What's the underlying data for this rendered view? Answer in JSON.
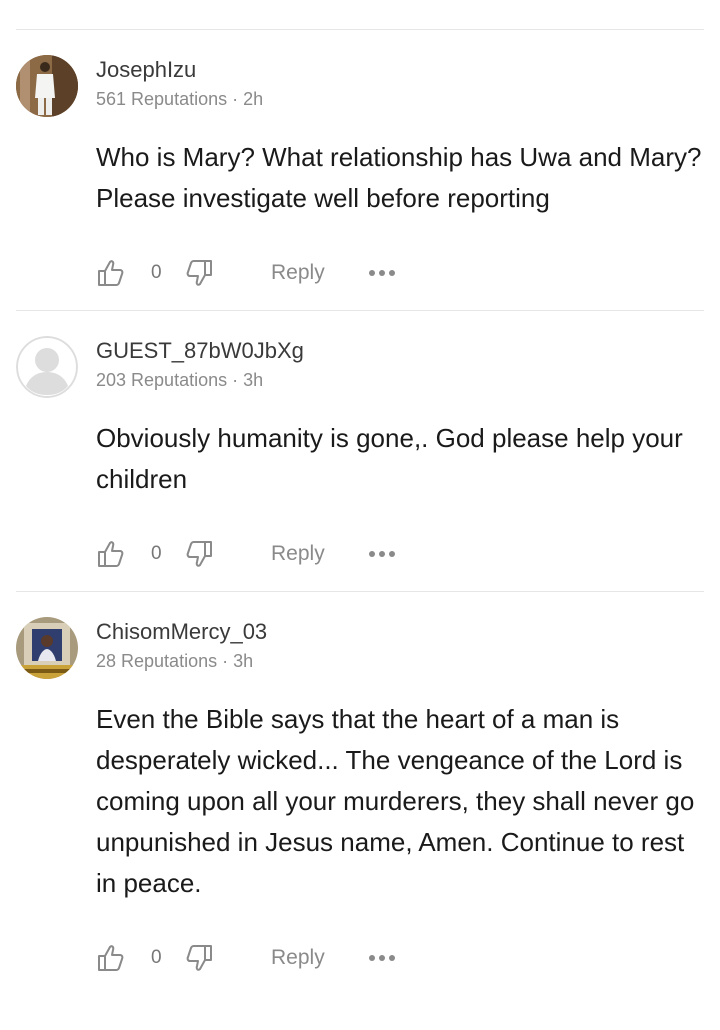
{
  "comments": [
    {
      "username": "JosephIzu",
      "reputation": "561 Reputations",
      "time": "2h",
      "text": "Who is Mary? What relationship has Uwa and Mary? Please investigate well before reporting",
      "likes": "0",
      "reply_label": "Reply",
      "avatar_icon": "user-photo-avatar-icon"
    },
    {
      "username": "GUEST_87bW0JbXg",
      "reputation": "203 Reputations",
      "time": "3h",
      "text": "Obviously humanity is gone,. God please help your children",
      "likes": "0",
      "reply_label": "Reply",
      "avatar_icon": "default-user-avatar-icon"
    },
    {
      "username": "ChisomMercy_03",
      "reputation": "28 Reputations",
      "time": "3h",
      "text": "Even the Bible says that the heart of a man is desperately wicked... The vengeance of the Lord is coming upon all your murderers, they shall never go unpunished in Jesus name, Amen. Continue to rest in peace.",
      "likes": "0",
      "reply_label": "Reply",
      "avatar_icon": "user-photo-avatar-icon"
    }
  ],
  "separator": " · ",
  "icons": {
    "like": "thumbs-up-icon",
    "dislike": "thumbs-down-icon",
    "more": "more-options-icon"
  },
  "colors": {
    "text": "#1a1a1a",
    "muted": "#8a8a8a",
    "divider": "#e6e6e6"
  }
}
